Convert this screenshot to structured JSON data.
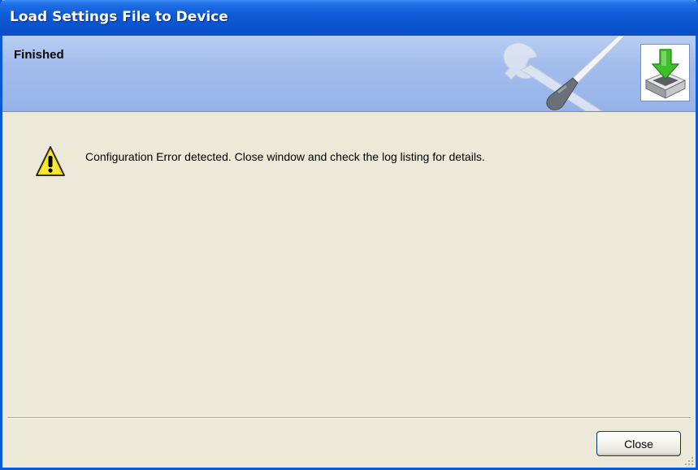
{
  "window": {
    "title": "Load Settings File to Device"
  },
  "header": {
    "title": "Finished",
    "wrench_icon": "tools-icon",
    "device_icon": "download-to-device-icon"
  },
  "content": {
    "warning_icon": "warning-icon",
    "message": "Configuration Error detected. Close window and check the log listing for details."
  },
  "footer": {
    "close_label": "Close"
  },
  "colors": {
    "titlebar": "#0a54d0",
    "header_band": "#a2bcec",
    "body": "#ece9d8",
    "warning_fill": "#f6e20e",
    "arrow_green": "#3fbf2a"
  }
}
